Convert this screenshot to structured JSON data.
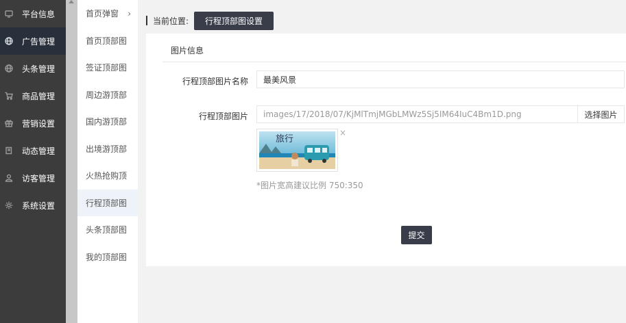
{
  "sidebar": {
    "items": [
      {
        "icon": "monitor-icon",
        "label": "平台信息"
      },
      {
        "icon": "globe-icon",
        "label": "广告管理",
        "active": true
      },
      {
        "icon": "globe-icon",
        "label": "头条管理"
      },
      {
        "icon": "cart-icon",
        "label": "商品管理"
      },
      {
        "icon": "gift-icon",
        "label": "营销设置"
      },
      {
        "icon": "book-icon",
        "label": "动态管理"
      },
      {
        "icon": "user-icon",
        "label": "访客管理"
      },
      {
        "icon": "gear-icon",
        "label": "系统设置"
      }
    ]
  },
  "submenu": {
    "items": [
      "首页弹窗",
      "首页顶部图",
      "签证顶部图",
      "周边游顶部",
      "国内游顶部",
      "出境游顶部",
      "火热抢购顶",
      "行程顶部图",
      "头条顶部图",
      "我的顶部图"
    ],
    "active_index": 7,
    "first_arrow": "›"
  },
  "breadcrumb": {
    "label": "当前位置:",
    "current": "行程顶部图设置"
  },
  "form": {
    "section_title": "图片信息",
    "name_label": "行程顶部图片名称",
    "name_value": "最美风景",
    "image_label": "行程顶部图片",
    "image_path": "images/17/2018/07/KjMlTmjMGbLMWz5Sj5IM64IuC4Bm1D.png",
    "choose_button": "选择图片",
    "thumb_text": "旅行",
    "remove_icon": "×",
    "hint": "*图片宽高建议比例 750:350",
    "submit": "提交"
  },
  "colors": {
    "sidebar_bg": "#3c3c3c",
    "sidebar_active": "#28303b",
    "button_dark": "#393d49"
  }
}
